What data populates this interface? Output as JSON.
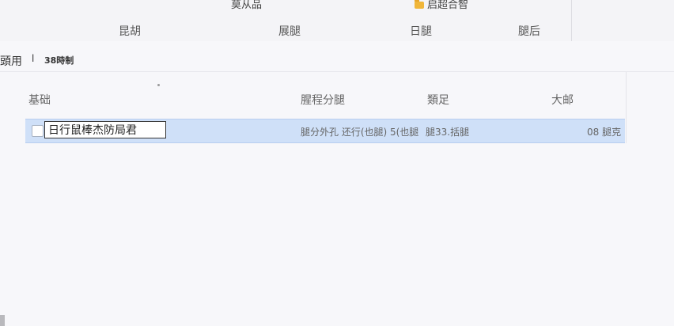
{
  "top_tabs": [
    {
      "label": "莫从品"
    },
    {
      "label": "启超合智"
    }
  ],
  "column_bar": {
    "c1": "昆胡",
    "c2": "展腿",
    "c3": "日腿",
    "c4": "腿后"
  },
  "breadcrumb": {
    "root": "頭用",
    "separator": "l",
    "current": "38時制"
  },
  "list_header": {
    "name": "基础",
    "modified": "腥程分腿",
    "type": "類足",
    "size": "大邮"
  },
  "rows": [
    {
      "name_value": "日行鼠棒杰防局君",
      "modified": "腿分外孔 还行(也腿) 5(也腿",
      "type": "腿33.括腿",
      "size": "08 腿克"
    }
  ],
  "colors": {
    "selected_row": "#cfe0f8",
    "folder": "#f0b63a"
  },
  "icons": [
    "folder-icon",
    "checkbox"
  ]
}
